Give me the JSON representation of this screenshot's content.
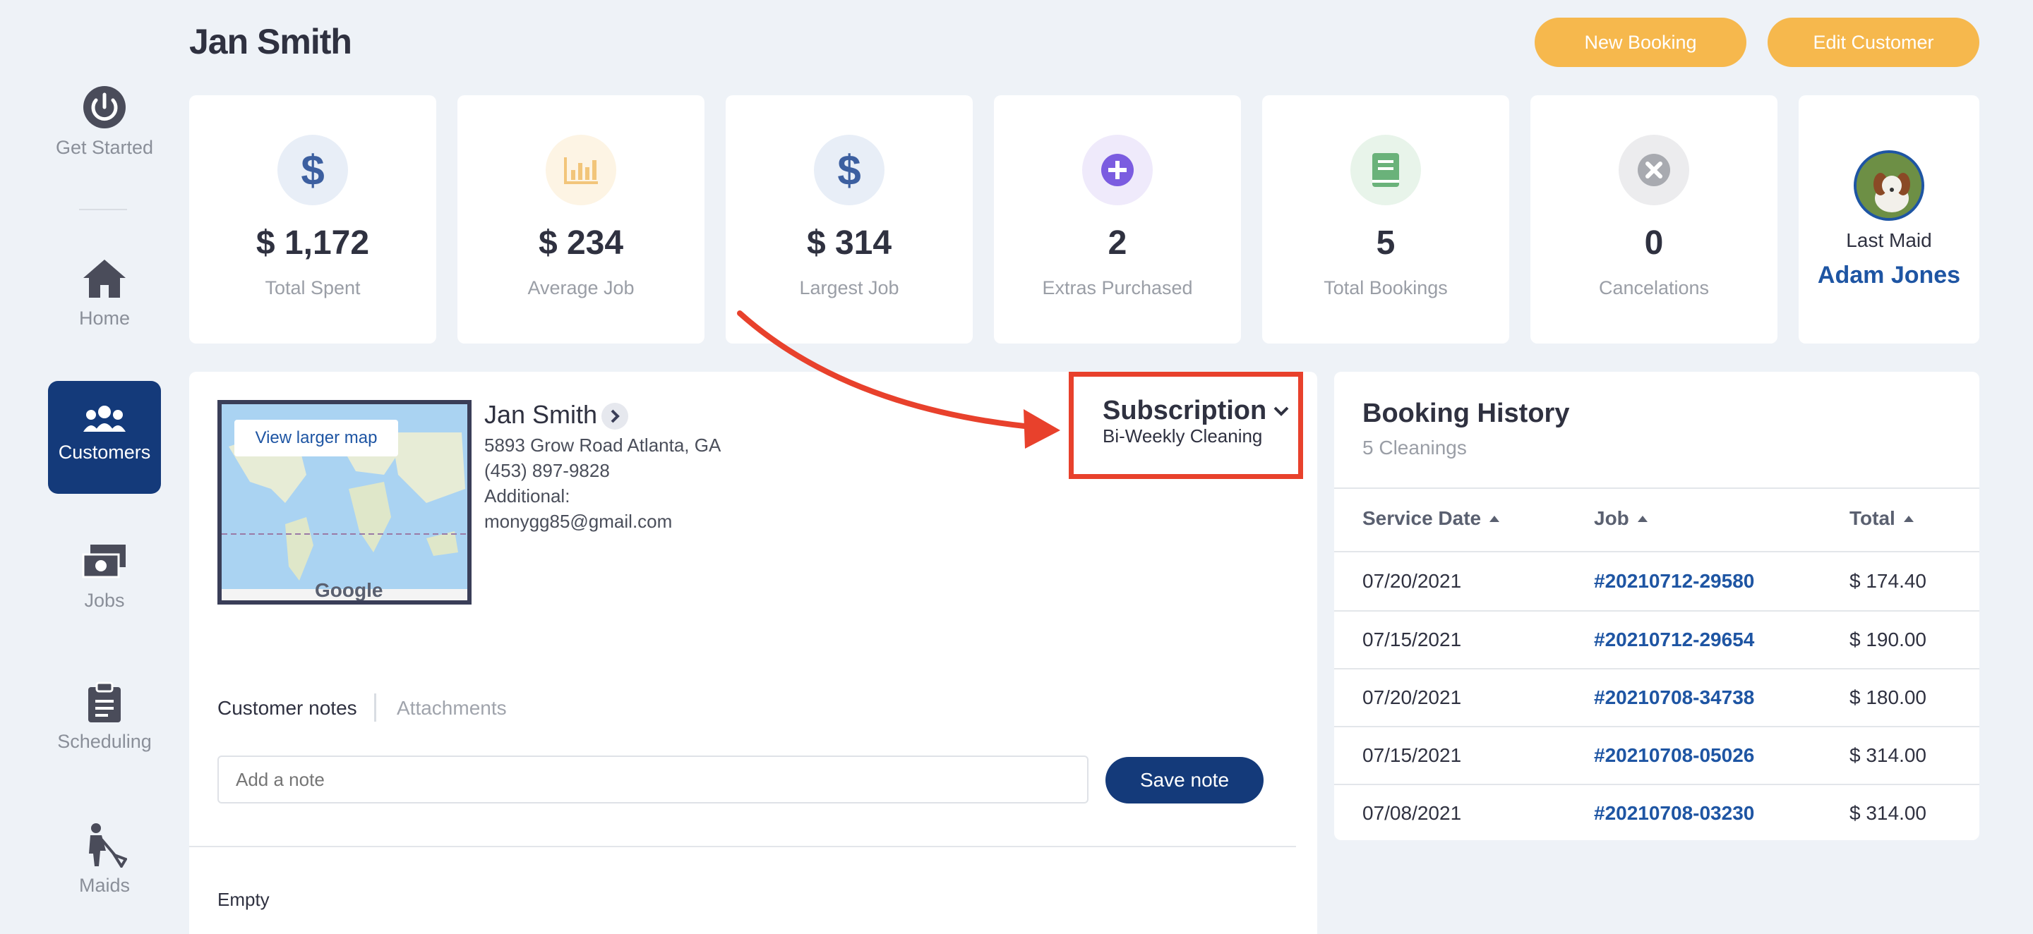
{
  "sidebar": {
    "items": [
      {
        "label": "Get Started",
        "icon": "power-icon"
      },
      {
        "label": "Home",
        "icon": "home-icon"
      },
      {
        "label": "Customers",
        "icon": "users-icon"
      },
      {
        "label": "Jobs",
        "icon": "money-icon"
      },
      {
        "label": "Scheduling",
        "icon": "clipboard-icon"
      },
      {
        "label": "Maids",
        "icon": "maid-icon"
      }
    ],
    "active": "Customers"
  },
  "header": {
    "title": "Jan Smith",
    "new_booking": "New Booking",
    "edit_customer": "Edit Customer"
  },
  "stats": [
    {
      "value": "$ 1,172",
      "label": "Total Spent",
      "icon": "dollar-icon"
    },
    {
      "value": "$ 234",
      "label": "Average Job",
      "icon": "chart-icon"
    },
    {
      "value": "$ 314",
      "label": "Largest Job",
      "icon": "dollar-icon"
    },
    {
      "value": "2",
      "label": "Extras Purchased",
      "icon": "plus-icon"
    },
    {
      "value": "5",
      "label": "Total Bookings",
      "icon": "book-icon"
    },
    {
      "value": "0",
      "label": "Cancelations",
      "icon": "x-icon"
    }
  ],
  "last_maid": {
    "label": "Last Maid",
    "name": "Adam Jones"
  },
  "customer": {
    "map_button": "View larger map",
    "map_brand": "Google",
    "name": "Jan Smith",
    "address": "5893 Grow Road Atlanta, GA",
    "phone": "(453) 897-9828",
    "additional": "Additional:",
    "email": "monygg85@gmail.com",
    "subscription_title": "Subscription",
    "subscription_value": "Bi-Weekly Cleaning",
    "tabs": [
      "Customer notes",
      "Attachments"
    ],
    "note_placeholder": "Add a note",
    "save_note": "Save note",
    "empty": "Empty"
  },
  "booking_history": {
    "title": "Booking History",
    "subtitle": "5 Cleanings",
    "columns": [
      "Service Date",
      "Job",
      "Total"
    ],
    "rows": [
      [
        "07/20/2021",
        "#20210712-29580",
        "$ 174.40"
      ],
      [
        "07/15/2021",
        "#20210712-29654",
        "$ 190.00"
      ],
      [
        "07/20/2021",
        "#20210708-34738",
        "$ 180.00"
      ],
      [
        "07/15/2021",
        "#20210708-05026",
        "$ 314.00"
      ],
      [
        "07/08/2021",
        "#20210708-03230",
        "$ 314.00"
      ]
    ]
  },
  "colors": {
    "accent_orange": "#f6b84d",
    "nav_active": "#143a7a",
    "link_blue": "#1e55a3",
    "annotation_red": "#e8412c"
  }
}
